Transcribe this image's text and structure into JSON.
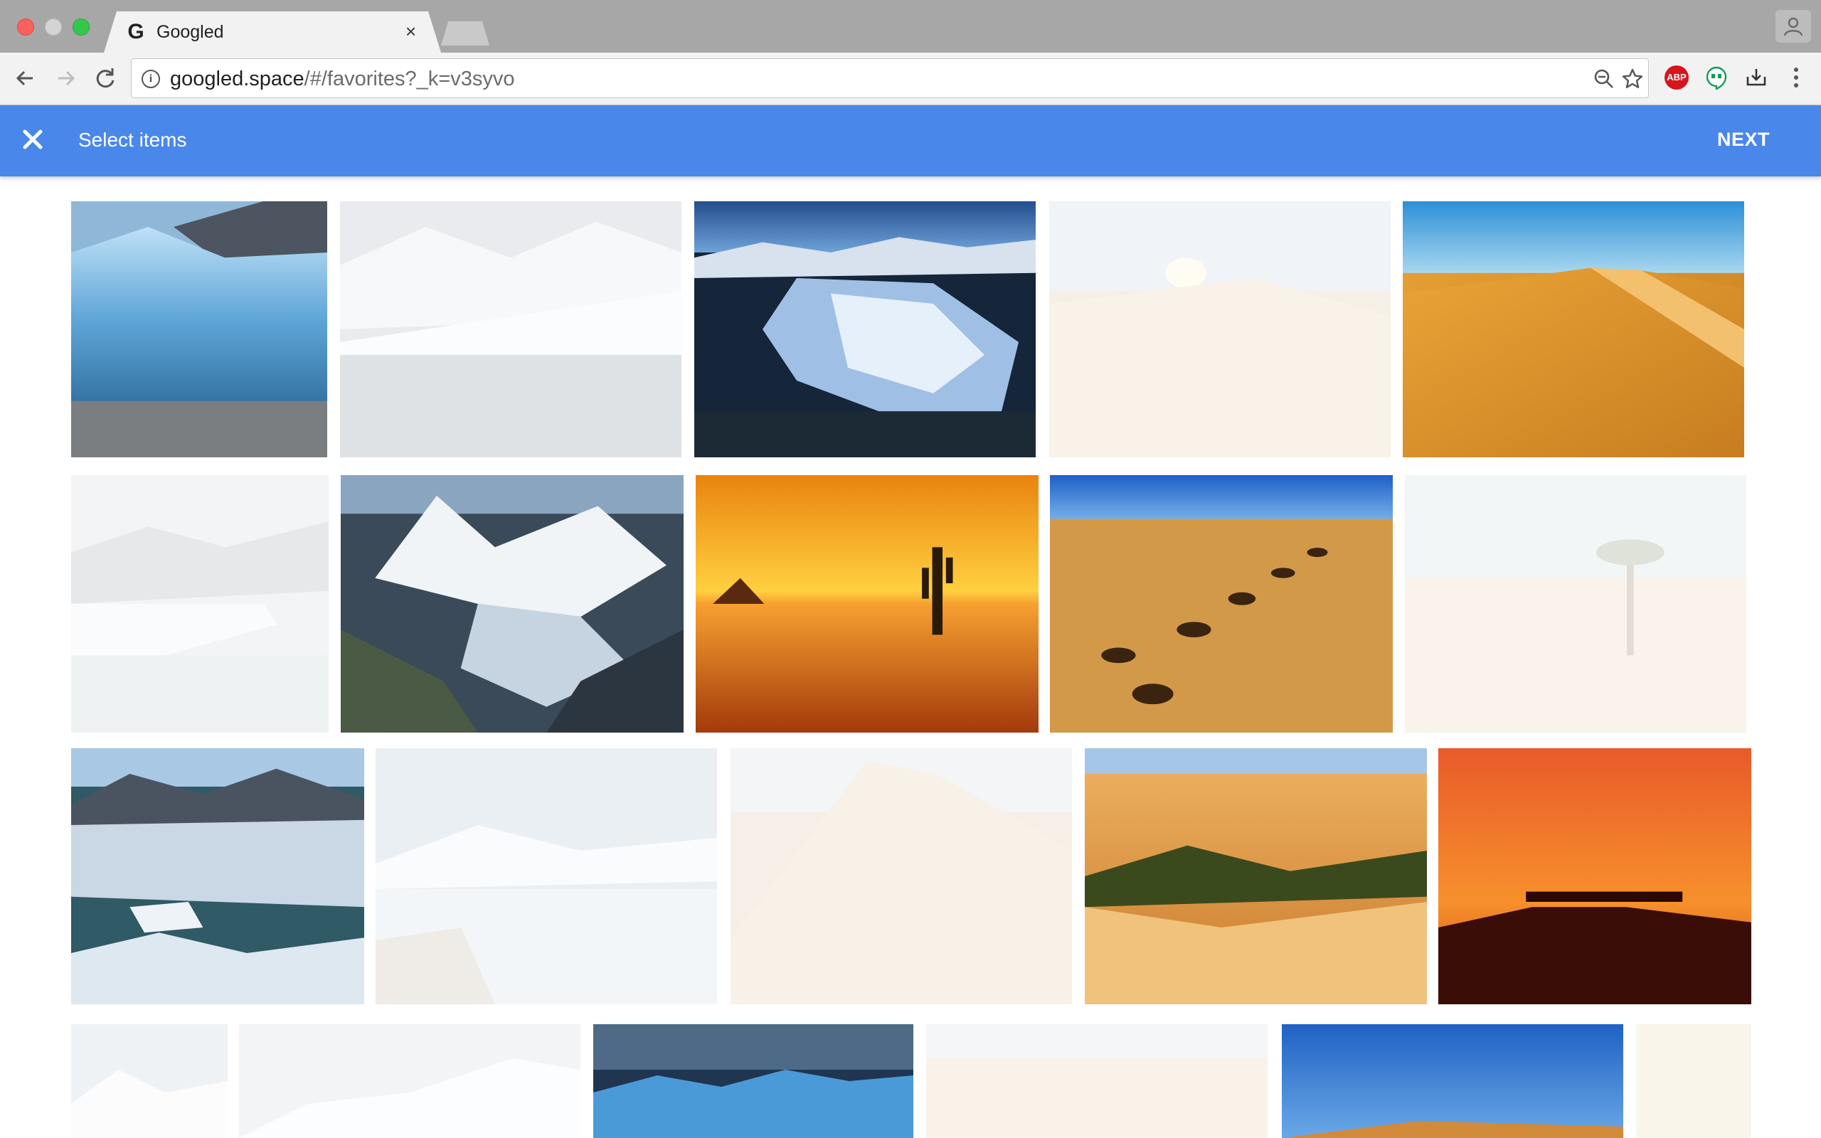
{
  "browser": {
    "tab_title": "Googled",
    "tab_favicon": "G",
    "tab_close": "×",
    "url_host": "googled.space",
    "url_rest": "/#/favorites?_k=v3syvo",
    "extension_abp_label": "ABP"
  },
  "appbar": {
    "title": "Select items",
    "next_label": "NEXT",
    "color": "#4a87ea"
  },
  "photos": [
    {
      "name": "glacier-ice-wall",
      "selected": true
    },
    {
      "name": "glacier-valley-aerial",
      "selected": false
    },
    {
      "name": "glacier-tongue-aerial",
      "selected": true
    },
    {
      "name": "desert-sunburst",
      "selected": false
    },
    {
      "name": "desert-dunes-blue-sky",
      "selected": true
    },
    {
      "name": "glacier-fog",
      "selected": false
    },
    {
      "name": "glacier-mountain-aerial",
      "selected": true
    },
    {
      "name": "desert-cactus-sunset",
      "selected": true
    },
    {
      "name": "desert-footprints",
      "selected": true
    },
    {
      "name": "desert-palm-tree",
      "selected": false
    },
    {
      "name": "glacier-lake-icebergs",
      "selected": true
    },
    {
      "name": "glacier-bay-ice",
      "selected": false
    },
    {
      "name": "desert-dune-pale",
      "selected": false
    },
    {
      "name": "desert-oasis-palms",
      "selected": true
    },
    {
      "name": "desert-camels-sunset",
      "selected": true
    },
    {
      "name": "snow-mountain-partial",
      "selected": false
    },
    {
      "name": "iceberg-partial",
      "selected": false
    },
    {
      "name": "blue-glacier-front",
      "selected": true
    },
    {
      "name": "dunes-pale-partial",
      "selected": false
    },
    {
      "name": "desert-blue-sky-partial",
      "selected": true
    },
    {
      "name": "sand-partial",
      "selected": false
    }
  ]
}
